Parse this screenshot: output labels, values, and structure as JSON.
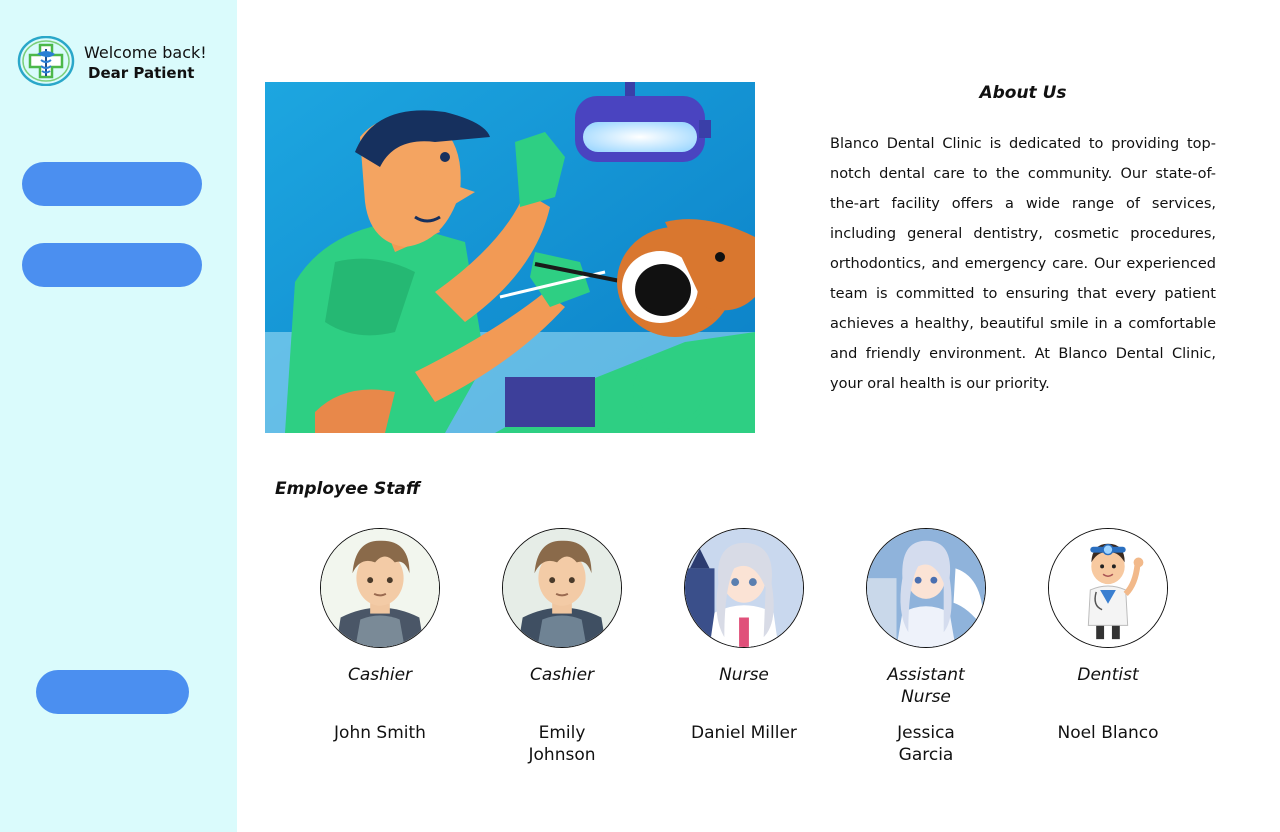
{
  "sidebar": {
    "welcome": "Welcome back!",
    "patient": "Dear Patient",
    "logo_icon": "medical-caduceus-icon",
    "buttons": [
      {
        "label": ""
      },
      {
        "label": ""
      },
      {
        "label": ""
      }
    ],
    "accent_color": "#4b8ff0",
    "background_color": "#dafbfc"
  },
  "about": {
    "title": "About Us",
    "text": "Blanco Dental Clinic is dedicated to providing top-notch dental care to the community. Our state-of-the-art facility offers a wide range of services, including general dentistry, cosmetic procedures, orthodontics, and emergency care. Our experienced team is committed to ensuring that every patient achieves a healthy, beautiful smile in a comfortable and friendly environment. At Blanco Dental Clinic, your oral health is our priority."
  },
  "staff": {
    "title": "Employee Staff",
    "members": [
      {
        "role": "Cashier",
        "name": "John Smith"
      },
      {
        "role": "Cashier",
        "name": "Emily Johnson"
      },
      {
        "role": "Nurse",
        "name": "Daniel Miller"
      },
      {
        "role": "Assistant Nurse",
        "name": "Jessica Garcia"
      },
      {
        "role": "Dentist",
        "name": "Noel Blanco"
      }
    ]
  }
}
